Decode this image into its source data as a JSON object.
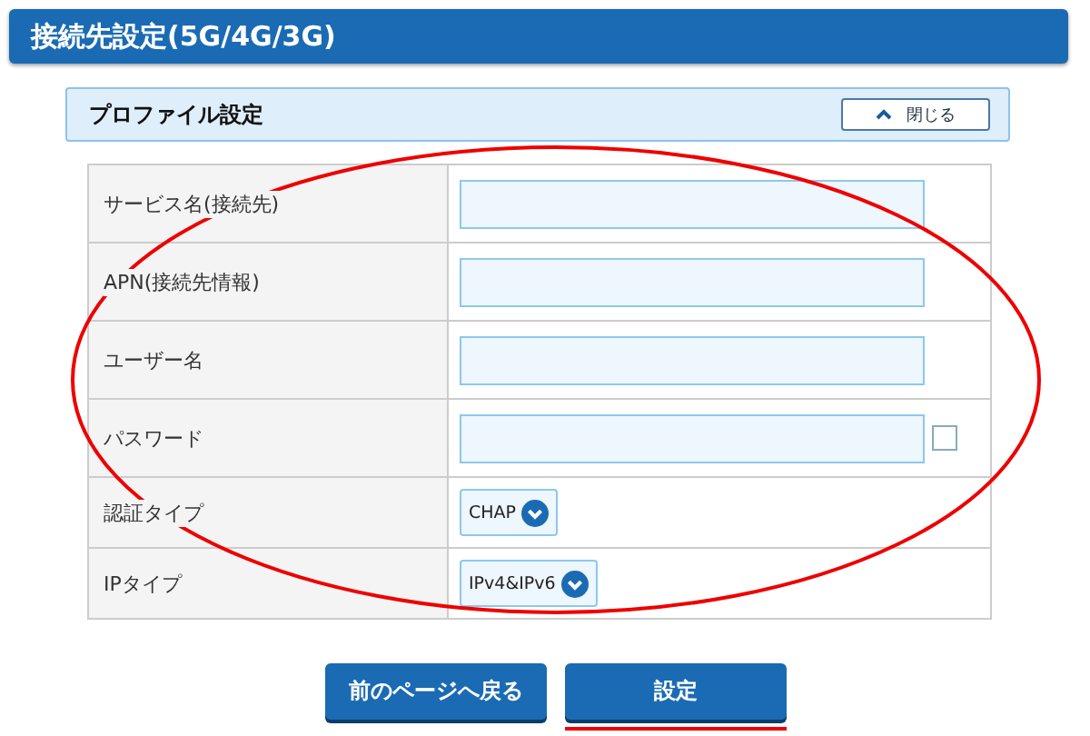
{
  "header": {
    "title": "接続先設定(5G/4G/3G)"
  },
  "section": {
    "title": "プロファイル設定",
    "toggle_label": "閉じる",
    "expanded": true
  },
  "rows": [
    {
      "label": "サービス名(接続先)",
      "kind": "input"
    },
    {
      "label": "APN(接続先情報)",
      "kind": "input"
    },
    {
      "label": "ユーザー名",
      "kind": "input"
    },
    {
      "label": "パスワード",
      "kind": "password",
      "checked": false
    },
    {
      "label": "認証タイプ",
      "kind": "select",
      "value": "CHAP"
    },
    {
      "label": "IPタイプ",
      "kind": "select",
      "value": "IPv4&IPv6"
    }
  ],
  "buttons": [
    {
      "label": "前のページへ戻る",
      "underlined": false
    },
    {
      "label": "設定",
      "underlined": true
    }
  ],
  "annotation": {
    "ellipse": true
  }
}
